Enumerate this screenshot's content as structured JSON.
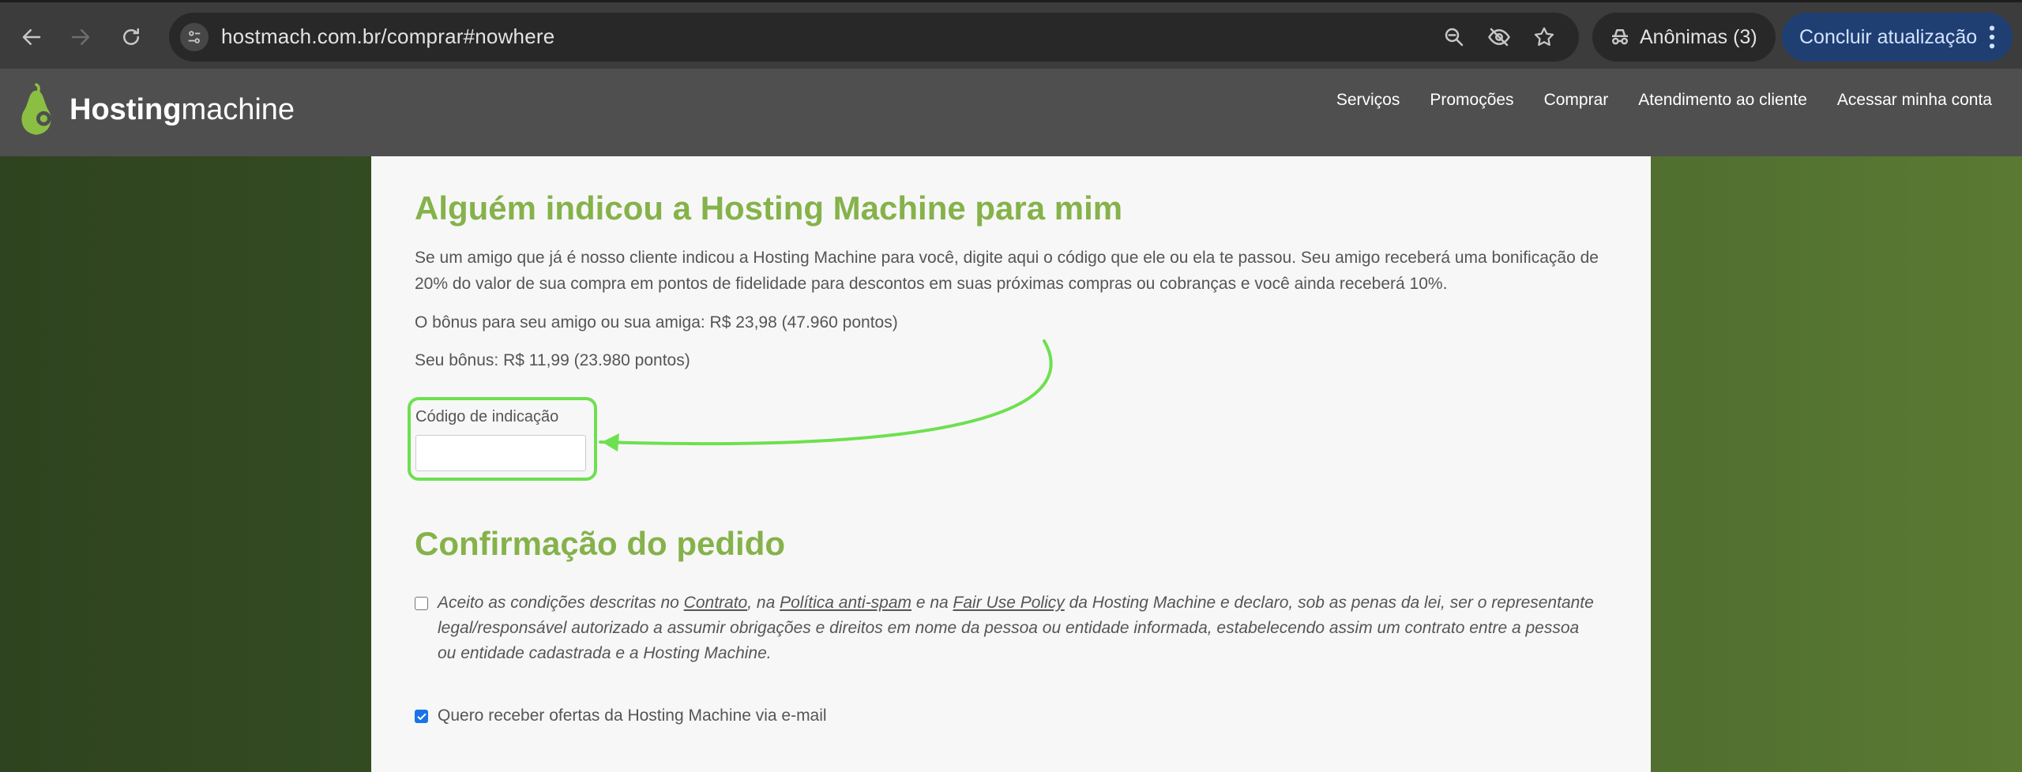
{
  "browser": {
    "url": "hostmach.com.br/comprar#nowhere",
    "incognito_label": "Anônimas (3)",
    "update_label": "Concluir atualização"
  },
  "site": {
    "logo_bold": "Hosting",
    "logo_light": "machine",
    "nav": [
      "Serviços",
      "Promoções",
      "Comprar",
      "Atendimento ao cliente",
      "Acessar minha conta"
    ]
  },
  "referral": {
    "title": "Alguém indicou a Hosting Machine para mim",
    "description": "Se um amigo que já é nosso cliente indicou a Hosting Machine para você, digite aqui o código que ele ou ela te passou. Seu amigo receberá uma bonificação de 20% do valor de sua compra em pontos de fidelidade para descontos em suas próximas compras ou cobranças e você ainda receberá 10%.",
    "friend_bonus": "O bônus para seu amigo ou sua amiga: R$ 23,98 (47.960 pontos)",
    "your_bonus": "Seu bônus: R$ 11,99 (23.980 pontos)",
    "code_label": "Código de indicação",
    "code_value": ""
  },
  "confirmation": {
    "title": "Confirmação do pedido",
    "terms_prefix": "Aceito as condições descritas no ",
    "terms_link_contract": "Contrato",
    "terms_mid1": ", na ",
    "terms_link_antispam": "Política anti-spam",
    "terms_mid2": " e na ",
    "terms_link_fairuse": "Fair Use Policy",
    "terms_suffix": " da Hosting Machine e declaro, sob as penas da lei, ser o representante legal/responsável autorizado a assumir obrigações e direitos em nome da pessoa ou entidade informada, estabelecendo assim um contrato entre a pessoa ou entidade cadastrada e a Hosting Machine.",
    "terms_checked": false,
    "optin_label": "Quero receber ofertas da Hosting Machine via e-mail",
    "optin_checked": true
  },
  "colors": {
    "heading": "#85b24a",
    "highlight": "#6de04f",
    "checkbox": "#1a73e8"
  }
}
